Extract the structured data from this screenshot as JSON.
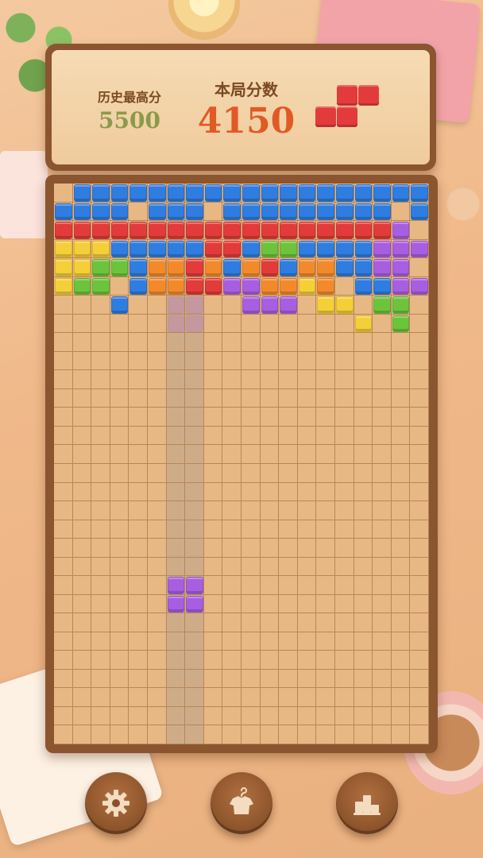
{
  "score": {
    "best_label": "历史最高分",
    "best_value": "5500",
    "current_label": "本局分数",
    "current_value": "4150"
  },
  "board": {
    "cols": 20,
    "rows": 30,
    "colors": {
      "B": "#2f7de0",
      "R": "#e33b3b",
      "Y": "#f5cf38",
      "G": "#6cc43c",
      "O": "#f28a2c",
      "P": "#a85ee0"
    },
    "rows_data": [
      ".BBBBBBBBBBBBBBBBBBB",
      "BBBB.BBB.BBBBBBBBB.B",
      "RRRRRRRRRRRRRRRRRRP.",
      "YYYBBBBBRRBGGBBBBPPP",
      "YYGGBOOROBORBOOBBPP.",
      "YGG.BOORRPPOOYO.BBPP",
      "...B......PPP.YY.GG.",
      "................Y.G."
    ],
    "ghost_column_start": 6,
    "ghost_column_width": 2,
    "ghost_piece": [
      [
        6,
        6
      ],
      [
        7,
        6
      ],
      [
        6,
        7
      ],
      [
        7,
        7
      ]
    ],
    "active_piece_color": "P",
    "active_piece": [
      [
        6,
        21
      ],
      [
        7,
        21
      ],
      [
        6,
        22
      ],
      [
        7,
        22
      ]
    ]
  },
  "next_piece": {
    "color": "R",
    "shape": "S",
    "cells": [
      [
        1,
        0
      ],
      [
        2,
        0
      ],
      [
        0,
        1
      ],
      [
        1,
        1
      ]
    ]
  },
  "buttons": {
    "settings": "gear-icon",
    "skins": "shirt-hanger-icon",
    "leaderboard": "podium-icon"
  }
}
